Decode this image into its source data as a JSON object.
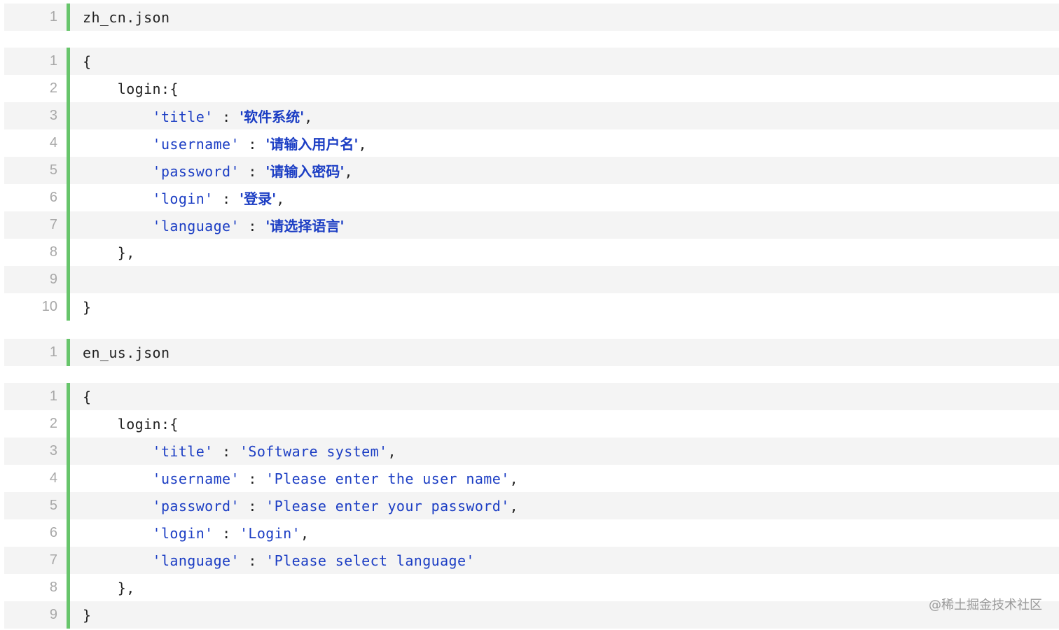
{
  "files": {
    "zh": {
      "name_line_no": "1",
      "name": "zh_cn.json",
      "lines": [
        {
          "no": "1",
          "indent": "",
          "key": "",
          "sep": "",
          "val": "",
          "end": "",
          "plain": "{"
        },
        {
          "no": "2",
          "indent": "    ",
          "key": "",
          "sep": "",
          "val": "",
          "end": "",
          "plain": "login:{"
        },
        {
          "no": "3",
          "indent": "        ",
          "key": "'title'",
          "sep": " : ",
          "val": "'软件系统'",
          "end": ",",
          "plain": ""
        },
        {
          "no": "4",
          "indent": "        ",
          "key": "'username'",
          "sep": " : ",
          "val": "'请输入用户名'",
          "end": ",",
          "plain": ""
        },
        {
          "no": "5",
          "indent": "        ",
          "key": "'password'",
          "sep": " : ",
          "val": "'请输入密码'",
          "end": ",",
          "plain": ""
        },
        {
          "no": "6",
          "indent": "        ",
          "key": "'login'",
          "sep": " : ",
          "val": "'登录'",
          "end": ",",
          "plain": ""
        },
        {
          "no": "7",
          "indent": "        ",
          "key": "'language'",
          "sep": " : ",
          "val": "'请选择语言'",
          "end": "",
          "plain": ""
        },
        {
          "no": "8",
          "indent": "    ",
          "key": "",
          "sep": "",
          "val": "",
          "end": "",
          "plain": "},"
        },
        {
          "no": "9",
          "indent": "",
          "key": "",
          "sep": "",
          "val": "",
          "end": "",
          "plain": ""
        },
        {
          "no": "10",
          "indent": "",
          "key": "",
          "sep": "",
          "val": "",
          "end": "",
          "plain": "}"
        }
      ]
    },
    "en": {
      "name_line_no": "1",
      "name": "en_us.json",
      "lines": [
        {
          "no": "1",
          "indent": "",
          "key": "",
          "sep": "",
          "val": "",
          "end": "",
          "plain": "{"
        },
        {
          "no": "2",
          "indent": "    ",
          "key": "",
          "sep": "",
          "val": "",
          "end": "",
          "plain": "login:{"
        },
        {
          "no": "3",
          "indent": "        ",
          "key": "'title'",
          "sep": " : ",
          "val": "'Software system'",
          "end": ",",
          "plain": ""
        },
        {
          "no": "4",
          "indent": "        ",
          "key": "'username'",
          "sep": " : ",
          "val": "'Please enter the user name'",
          "end": ",",
          "plain": ""
        },
        {
          "no": "5",
          "indent": "        ",
          "key": "'password'",
          "sep": " : ",
          "val": "'Please enter your password'",
          "end": ",",
          "plain": ""
        },
        {
          "no": "6",
          "indent": "        ",
          "key": "'login'",
          "sep": " : ",
          "val": "'Login'",
          "end": ",",
          "plain": ""
        },
        {
          "no": "7",
          "indent": "        ",
          "key": "'language'",
          "sep": " : ",
          "val": "'Please select language'",
          "end": "",
          "plain": ""
        },
        {
          "no": "8",
          "indent": "    ",
          "key": "",
          "sep": "",
          "val": "",
          "end": "",
          "plain": "},"
        },
        {
          "no": "9",
          "indent": "",
          "key": "",
          "sep": "",
          "val": "",
          "end": "",
          "plain": "}"
        }
      ]
    }
  },
  "watermark": "@稀土掘金技术社区",
  "colors": {
    "accent_bar": "#67c56b",
    "string": "#1c3ec4",
    "line_number": "#a8a8a8",
    "stripe": "#f4f4f4"
  }
}
